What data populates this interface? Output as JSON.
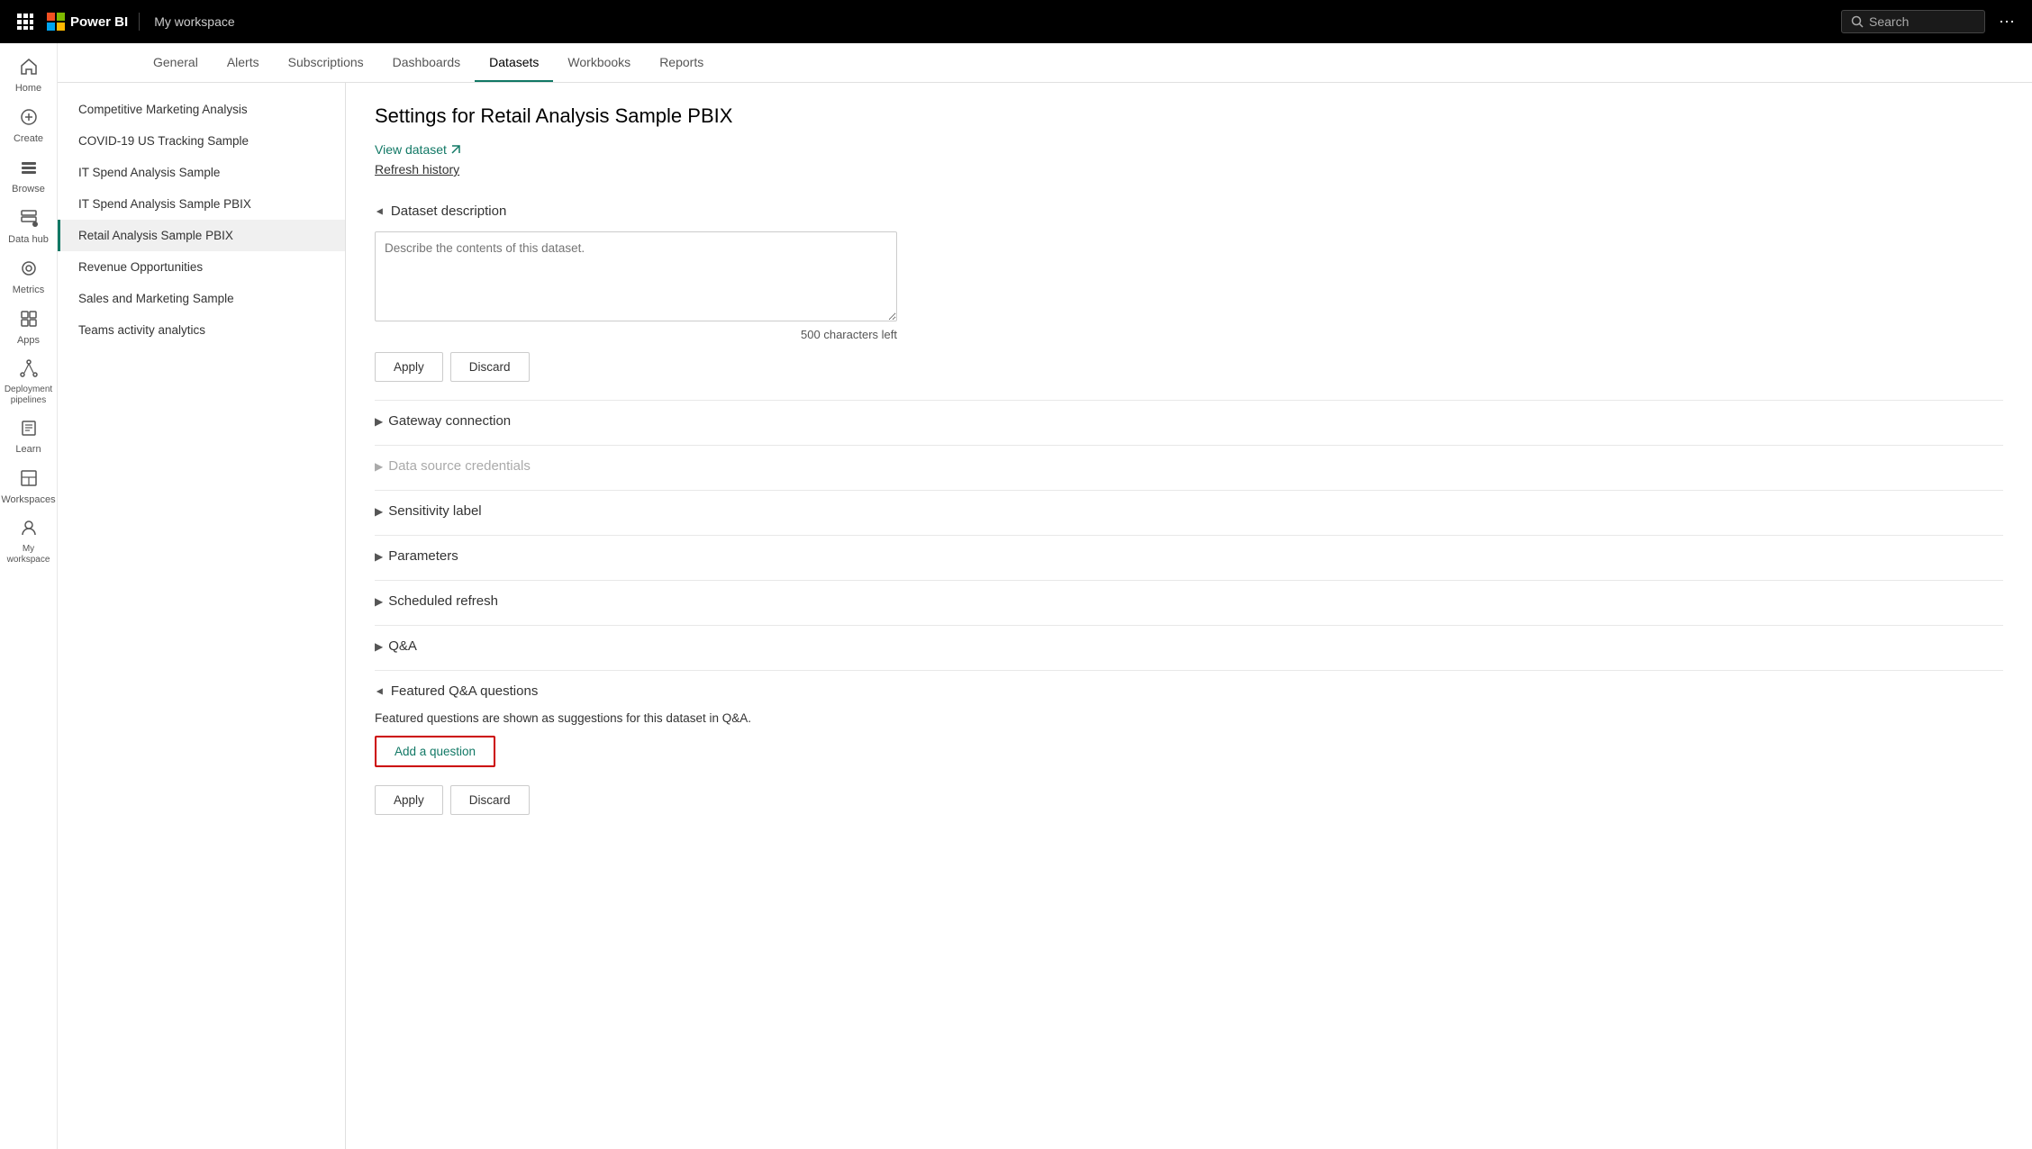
{
  "topbar": {
    "product": "Power BI",
    "workspace": "My workspace",
    "search_placeholder": "Search",
    "more_icon": "⋯"
  },
  "sidebar": {
    "items": [
      {
        "id": "home",
        "label": "Home",
        "icon": "🏠"
      },
      {
        "id": "create",
        "label": "Create",
        "icon": "+"
      },
      {
        "id": "browse",
        "label": "Browse",
        "icon": "☰"
      },
      {
        "id": "datahub",
        "label": "Data hub",
        "icon": "🗄"
      },
      {
        "id": "metrics",
        "label": "Metrics",
        "icon": "◎"
      },
      {
        "id": "apps",
        "label": "Apps",
        "icon": "⊞"
      },
      {
        "id": "deployment",
        "label": "Deployment pipelines",
        "icon": "⤴"
      },
      {
        "id": "learn",
        "label": "Learn",
        "icon": "📖"
      },
      {
        "id": "workspaces",
        "label": "Workspaces",
        "icon": "⊟"
      },
      {
        "id": "myworkspace",
        "label": "My workspace",
        "icon": "👤"
      }
    ]
  },
  "tabs": {
    "items": [
      {
        "id": "general",
        "label": "General"
      },
      {
        "id": "alerts",
        "label": "Alerts"
      },
      {
        "id": "subscriptions",
        "label": "Subscriptions"
      },
      {
        "id": "dashboards",
        "label": "Dashboards"
      },
      {
        "id": "datasets",
        "label": "Datasets",
        "active": true
      },
      {
        "id": "workbooks",
        "label": "Workbooks"
      },
      {
        "id": "reports",
        "label": "Reports"
      }
    ]
  },
  "dataset_list": {
    "items": [
      {
        "id": "competitive",
        "label": "Competitive Marketing Analysis"
      },
      {
        "id": "covid",
        "label": "COVID-19 US Tracking Sample"
      },
      {
        "id": "itspend",
        "label": "IT Spend Analysis Sample"
      },
      {
        "id": "itspendpbix",
        "label": "IT Spend Analysis Sample PBIX"
      },
      {
        "id": "retail",
        "label": "Retail Analysis Sample PBIX",
        "active": true
      },
      {
        "id": "revenue",
        "label": "Revenue Opportunities"
      },
      {
        "id": "sales",
        "label": "Sales and Marketing Sample"
      },
      {
        "id": "teams",
        "label": "Teams activity analytics"
      }
    ]
  },
  "settings": {
    "title": "Settings for Retail Analysis Sample PBIX",
    "view_dataset_label": "View dataset",
    "refresh_history_label": "Refresh history",
    "sections": {
      "dataset_description": {
        "label": "Dataset description",
        "expanded": true,
        "textarea_placeholder": "Describe the contents of this dataset.",
        "char_count": "500 characters left",
        "apply_label": "Apply",
        "discard_label": "Discard"
      },
      "gateway_connection": {
        "label": "Gateway connection",
        "expanded": false
      },
      "data_source_credentials": {
        "label": "Data source credentials",
        "expanded": false,
        "disabled": true
      },
      "sensitivity_label": {
        "label": "Sensitivity label",
        "expanded": false
      },
      "parameters": {
        "label": "Parameters",
        "expanded": false
      },
      "scheduled_refresh": {
        "label": "Scheduled refresh",
        "expanded": false
      },
      "qanda": {
        "label": "Q&A",
        "expanded": false
      },
      "featured_qanda": {
        "label": "Featured Q&A questions",
        "expanded": true,
        "description": "Featured questions are shown as suggestions for this dataset in Q&A.",
        "add_question_label": "Add a question",
        "apply_label": "Apply",
        "discard_label": "Discard"
      }
    }
  }
}
